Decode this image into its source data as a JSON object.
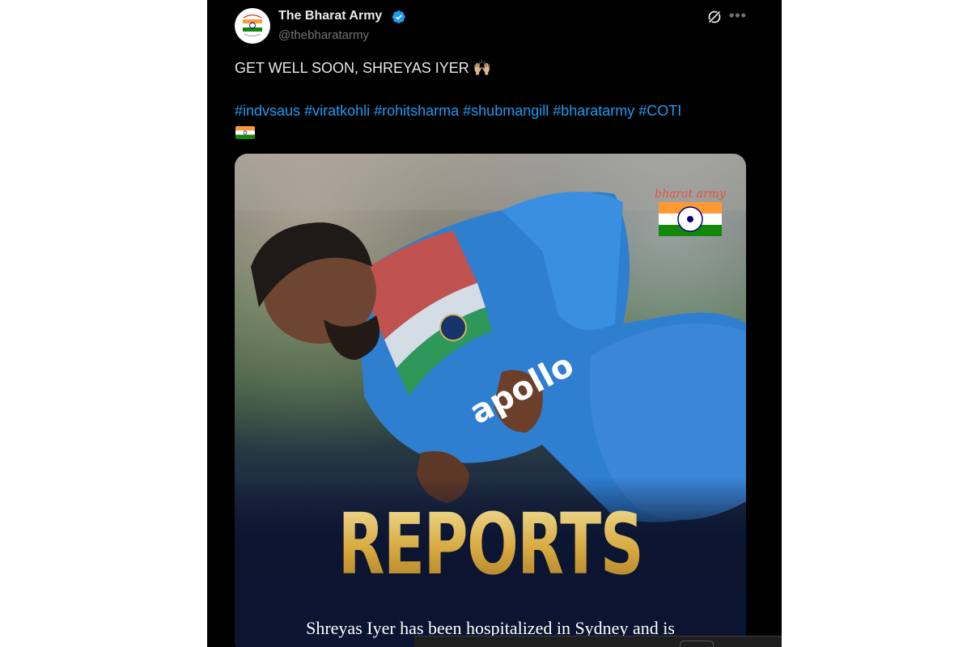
{
  "author": {
    "display_name": "The Bharat Army",
    "handle": "@thebharatarmy",
    "verified": true
  },
  "tweet": {
    "text": "GET WELL SOON, SHREYAS IYER 🙌🏼",
    "hashtags": [
      "#indvsaus",
      "#viratkohli",
      "#rohitsharma",
      "#shubmangill",
      "#bharatarmy",
      "#COTI"
    ],
    "trailing_emoji": "india-flag"
  },
  "media": {
    "headline": "REPORTS",
    "caption": "Shreyas Iyer has been hospitalized in Sydney and is",
    "jersey_sponsor": "apollo",
    "watermark_text": "bharat army"
  },
  "icons": [
    "verified-badge-icon",
    "grok-icon",
    "more-icon"
  ],
  "colors": {
    "background": "#000000",
    "text": "#e7e9ea",
    "secondary": "#71767b",
    "link": "#1d9bf0",
    "headline_gold": "#d9b55a"
  }
}
